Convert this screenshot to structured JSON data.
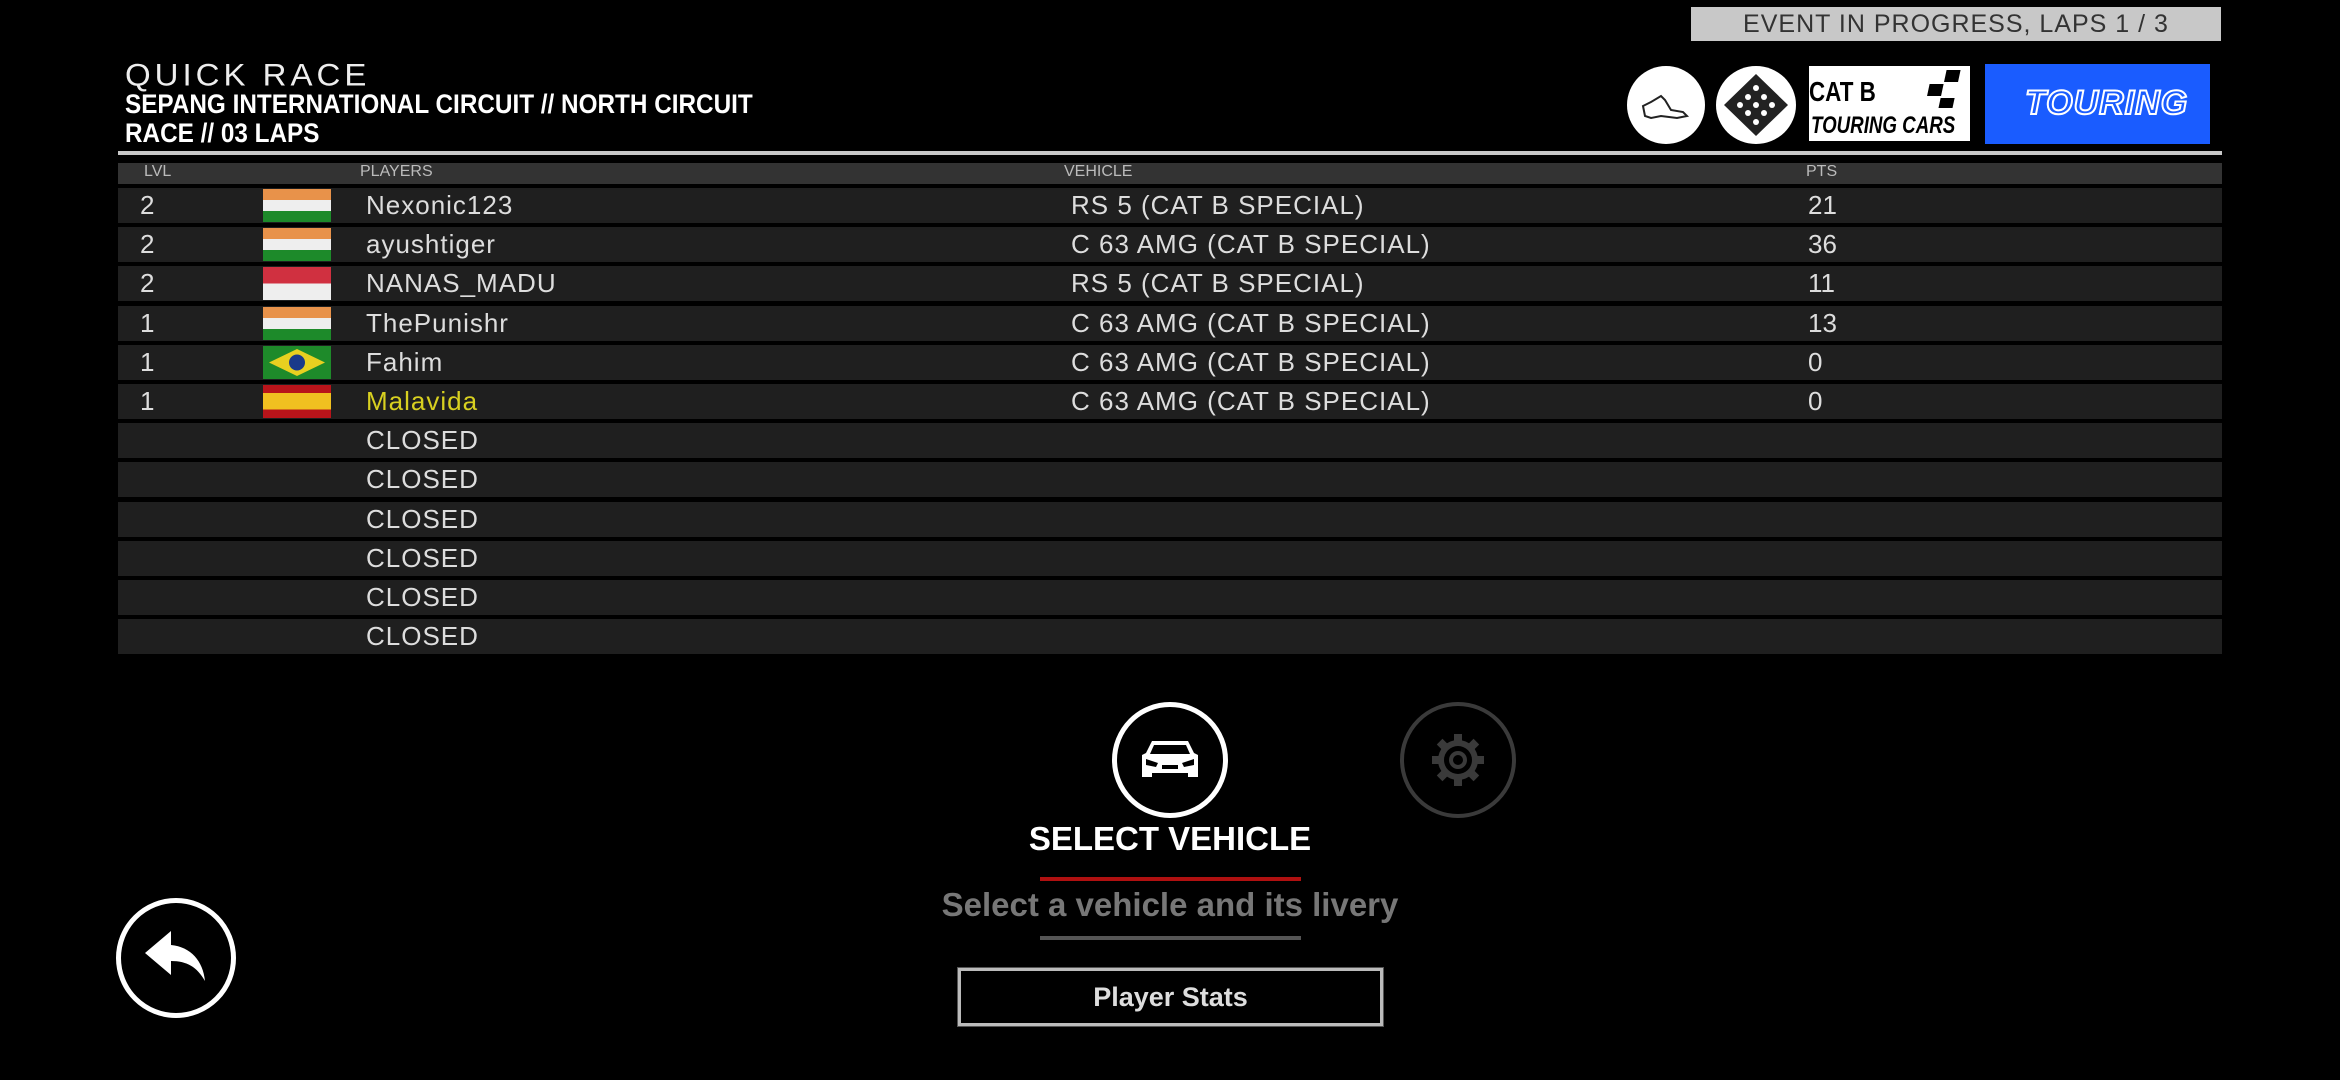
{
  "status": "EVENT IN PROGRESS, LAPS 1 / 3",
  "header": {
    "title": "QUICK RACE",
    "track": "SEPANG INTERNATIONAL CIRCUIT // NORTH CIRCUIT",
    "race": "RACE // 03 LAPS"
  },
  "badges": {
    "track_icon": "track-map-icon",
    "flag_icon": "checkered-flag-icon",
    "category": "CAT B",
    "category_sub": "TOURING CARS",
    "series": "TOURING",
    "series_color": "#1a5cff"
  },
  "table": {
    "columns": {
      "lvl": "LVL",
      "players": "PLAYERS",
      "vehicle": "VEHICLE",
      "pts": "PTS"
    },
    "rows": [
      {
        "lvl": "2",
        "flag": "india",
        "player": "Nexonic123",
        "vehicle": "RS 5 (CAT B SPECIAL)",
        "pts": "21"
      },
      {
        "lvl": "2",
        "flag": "india",
        "player": "ayushtiger",
        "vehicle": "C 63 AMG (CAT B SPECIAL)",
        "pts": "36"
      },
      {
        "lvl": "2",
        "flag": "indonesia",
        "player": "NANAS_MADU",
        "vehicle": "RS 5 (CAT B SPECIAL)",
        "pts": "11"
      },
      {
        "lvl": "1",
        "flag": "india",
        "player": "ThePunishr",
        "vehicle": "C 63 AMG (CAT B SPECIAL)",
        "pts": "13"
      },
      {
        "lvl": "1",
        "flag": "brazil",
        "player": "Fahim",
        "vehicle": "C 63 AMG (CAT B SPECIAL)",
        "pts": "0"
      },
      {
        "lvl": "1",
        "flag": "spain",
        "player": "Malavida",
        "vehicle": "C 63 AMG (CAT B SPECIAL)",
        "pts": "0",
        "highlight": "#d8d020"
      },
      {
        "lvl": "",
        "flag": "",
        "player": "CLOSED",
        "vehicle": "",
        "pts": ""
      },
      {
        "lvl": "",
        "flag": "",
        "player": "CLOSED",
        "vehicle": "",
        "pts": ""
      },
      {
        "lvl": "",
        "flag": "",
        "player": "CLOSED",
        "vehicle": "",
        "pts": ""
      },
      {
        "lvl": "",
        "flag": "",
        "player": "CLOSED",
        "vehicle": "",
        "pts": ""
      },
      {
        "lvl": "",
        "flag": "",
        "player": "CLOSED",
        "vehicle": "",
        "pts": ""
      },
      {
        "lvl": "",
        "flag": "",
        "player": "CLOSED",
        "vehicle": "",
        "pts": ""
      }
    ]
  },
  "actions": {
    "select_vehicle": "SELECT VEHICLE",
    "select_vehicle_desc": "Select a vehicle and its livery",
    "player_stats": "Player Stats",
    "accent": "#b01010"
  }
}
